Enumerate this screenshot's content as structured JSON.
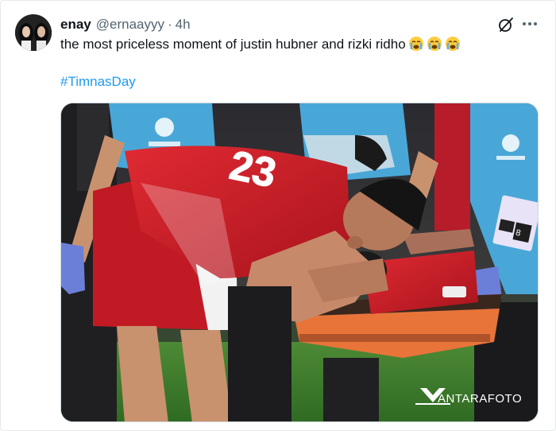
{
  "tweet": {
    "display_name": "enay",
    "handle": "@ernaayyy",
    "separator": "·",
    "time": "4h",
    "text": "the most priceless moment of justin hubner and rizki ridho",
    "emojis": [
      "crying-face",
      "crying-face",
      "crying-face"
    ],
    "hashtag": "#TimnasDay"
  },
  "media": {
    "watermark": "ANTARAFOTO",
    "jersey_number": "23",
    "bib_text": "TOP 8"
  },
  "icons": {
    "grok": "grok-icon",
    "more": "more-options-icon"
  },
  "colors": {
    "text": "#0f1419",
    "muted": "#536471",
    "link": "#1d9bf0",
    "border": "#cfd9de",
    "jersey_red": "#d61e2a",
    "staff_blue": "#49a7d8",
    "stretcher_orange": "#e8743a",
    "pitch_green": "#3f7c2e"
  }
}
